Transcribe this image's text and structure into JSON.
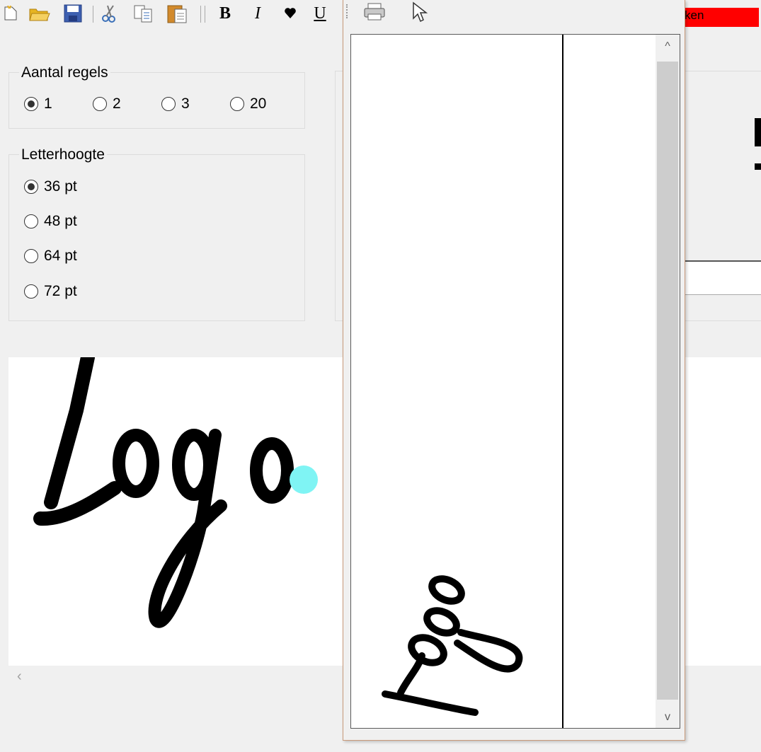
{
  "toolbar": {
    "bold_label": "B",
    "italic_label": "I",
    "underline_label": "U",
    "red_banner_text": "ken"
  },
  "aantal_regels": {
    "legend": "Aantal regels",
    "options": [
      "1",
      "2",
      "3",
      "20"
    ],
    "selected": "1"
  },
  "letterhoogte": {
    "legend": "Letterhoogte",
    "options": [
      "36 pt",
      "48 pt",
      "64 pt",
      "72 pt"
    ],
    "selected": "36 pt"
  },
  "preview": {
    "logo_text": "Logo",
    "dot_color": "#7ff4f4"
  },
  "popup": {
    "logo_text": "Logo",
    "scroll_up": "^",
    "scroll_down": "v"
  },
  "icons": [
    "new-document-icon",
    "open-folder-icon",
    "save-icon",
    "cut-icon",
    "copy-icon",
    "paste-icon",
    "heart-icon",
    "print-icon",
    "pointer-icon",
    "scroll-left-icon"
  ]
}
